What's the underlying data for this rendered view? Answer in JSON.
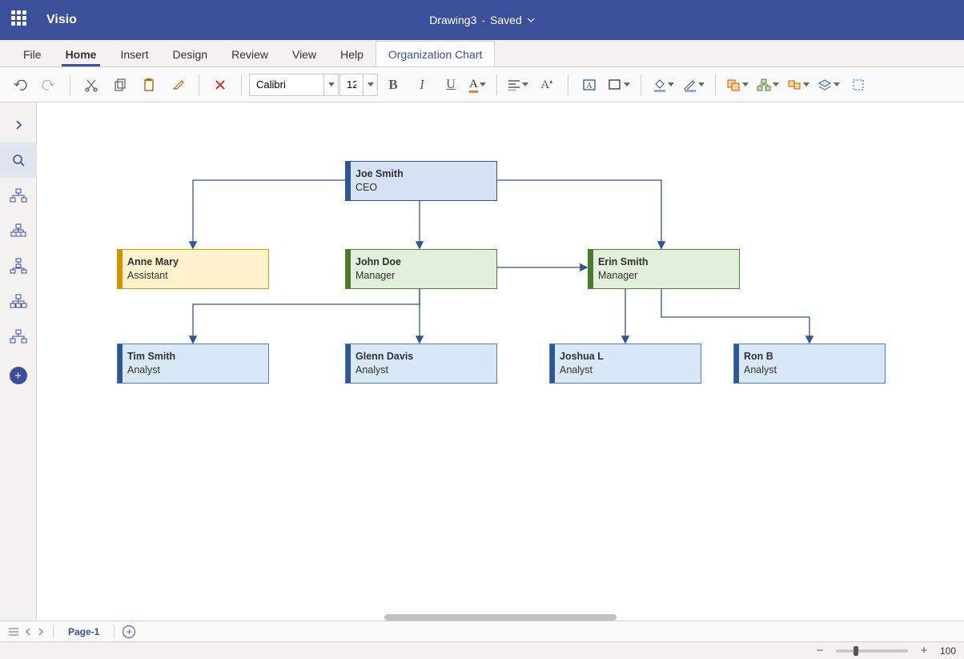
{
  "appName": "Visio",
  "document": {
    "name": "Drawing3",
    "status": "Saved"
  },
  "ribbonTabs": [
    {
      "id": "file",
      "label": "File"
    },
    {
      "id": "home",
      "label": "Home",
      "active": true
    },
    {
      "id": "insert",
      "label": "Insert"
    },
    {
      "id": "design",
      "label": "Design"
    },
    {
      "id": "review",
      "label": "Review"
    },
    {
      "id": "view",
      "label": "View"
    },
    {
      "id": "help",
      "label": "Help"
    },
    {
      "id": "orgchart",
      "label": "Organization Chart",
      "contextual": true
    }
  ],
  "toolbar": {
    "font": {
      "name": "Calibri",
      "size": "12"
    }
  },
  "chart_data": {
    "type": "org-chart",
    "nodes": [
      {
        "id": "ceo",
        "name": "Joe Smith",
        "title": "CEO",
        "role": "ceo",
        "parent": null
      },
      {
        "id": "assist",
        "name": "Anne Mary",
        "title": "Assistant",
        "role": "assistant",
        "parent": "ceo"
      },
      {
        "id": "mgr1",
        "name": "John Doe",
        "title": "Manager",
        "role": "manager",
        "parent": "ceo"
      },
      {
        "id": "mgr2",
        "name": "Erin Smith",
        "title": "Manager",
        "role": "manager",
        "parent": "ceo"
      },
      {
        "id": "an1",
        "name": "Tim Smith",
        "title": "Analyst",
        "role": "analyst",
        "parent": "mgr1"
      },
      {
        "id": "an2",
        "name": "Glenn Davis",
        "title": "Analyst",
        "role": "analyst",
        "parent": "mgr1"
      },
      {
        "id": "an3",
        "name": "Joshua L",
        "title": "Analyst",
        "role": "analyst",
        "parent": "mgr2"
      },
      {
        "id": "an4",
        "name": "Ron B",
        "title": "Analyst",
        "role": "analyst",
        "parent": "mgr2"
      }
    ]
  },
  "pages": [
    {
      "label": "Page-1"
    }
  ],
  "status": {
    "zoom": "100"
  }
}
